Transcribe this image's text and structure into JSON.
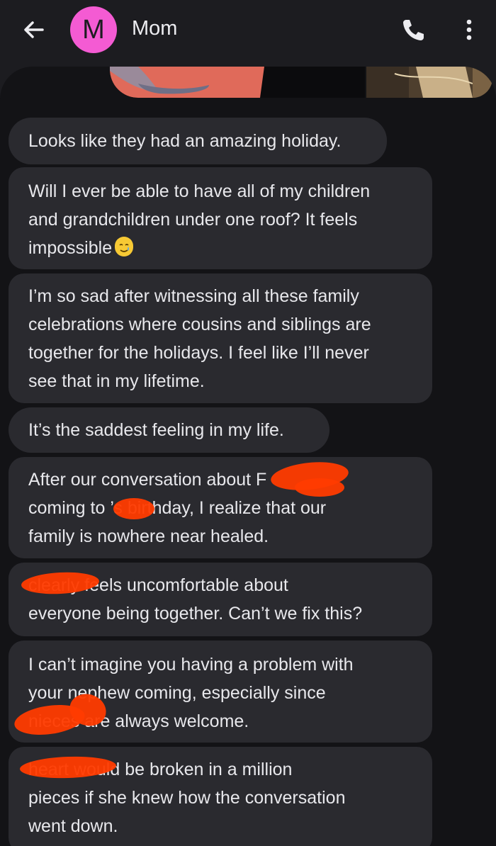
{
  "header": {
    "contact_initial": "M",
    "contact_name": "Mom",
    "avatar_color": "#f45bd3",
    "back_icon": "arrow-left-icon",
    "call_icon": "phone-icon",
    "more_icon": "more-vertical-icon"
  },
  "messages": [
    {
      "text": "Looks like they had an amazing holiday."
    },
    {
      "text": "Will I ever be able to have all of my children\nand grandchildren under one roof? It feels\nimpossible",
      "emoji": "smiling-face-with-tear-icon"
    },
    {
      "text": "I’m so sad after witnessing all these family\ncelebrations where cousins and siblings are\ntogether for the holidays. I feel like I’ll never\nsee that in my lifetime."
    },
    {
      "text": "It’s the saddest feeling in my life."
    },
    {
      "text": "After our conversation about F\ncoming to     ’s birthday, I realize that our\nfamily is nowhere near healed."
    },
    {
      "text": "             clearly feels uncomfortable about\neveryone being together. Can’t we fix this?"
    },
    {
      "text": "I can’t imagine you having a problem with\nyour nephew coming, especially since\n              nieces are always welcome."
    },
    {
      "text": "              heart would be broken in a million\npieces if she knew how the conversation\nwent down."
    }
  ],
  "colors": {
    "bubble": "#2a2a2f",
    "thread_background": "#131316",
    "app_background": "#1c1c20",
    "redaction": "#ff3b00"
  }
}
